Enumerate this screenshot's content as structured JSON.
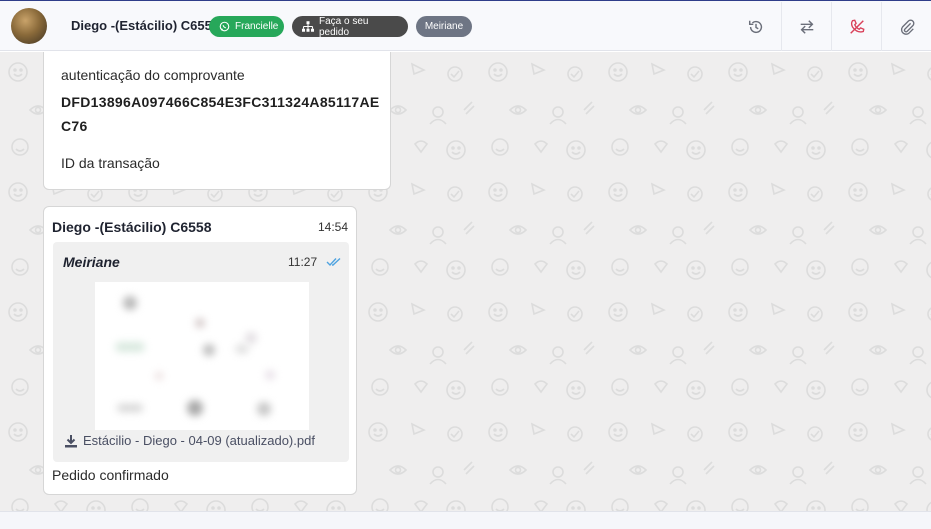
{
  "header": {
    "contact_name": "Diego -(Estácilio) C6558",
    "tags": [
      {
        "label": "Francielle",
        "icon": "whatsapp-icon",
        "color": "#27a85a"
      },
      {
        "label": "Faça o seu pedido",
        "icon": "sitemap-icon",
        "color": "#4a4a4a"
      },
      {
        "label": "Meiriane",
        "icon": "",
        "color": "#6e7584"
      }
    ],
    "actions": [
      "history-icon",
      "transfer-icon",
      "end-call-icon",
      "attach-icon"
    ]
  },
  "messages": [
    {
      "line1": "autenticação do comprovante",
      "code": "DFD13896A097466C854E3FC311324A85117AEC76",
      "line3": "ID da transação"
    },
    {
      "sender": "Diego -(Estácilio) C6558",
      "time": "14:54",
      "quoted": {
        "sender": "Meiriane",
        "time": "11:27",
        "file_name": "Estácilio - Diego - 04-09 (atualizado).pdf"
      },
      "text": "Pedido confirmado"
    }
  ],
  "colors": {
    "accent_green": "#27a85a",
    "end_call_red": "#d9415a",
    "chat_background": "#efeeee"
  }
}
